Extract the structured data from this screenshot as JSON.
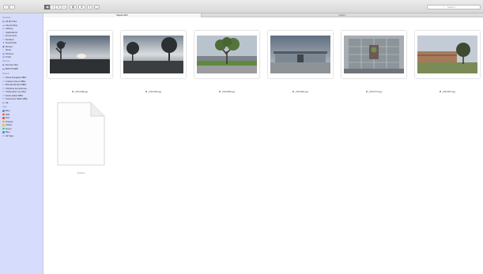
{
  "toolbar": {
    "view_modes": [
      "icon",
      "list",
      "column",
      "gallery"
    ],
    "search_placeholder": "Search"
  },
  "tabs": [
    {
      "label": "Nagano Mini",
      "active": true
    },
    {
      "label": "Nagano",
      "active": false
    }
  ],
  "sidebar": {
    "sections": [
      {
        "header": "Favorites",
        "items": [
          {
            "label": "All My Files",
            "icon": "all-files-icon"
          },
          {
            "label": "iCloud Drive",
            "icon": "cloud-icon"
          },
          {
            "label": "AirDrop",
            "icon": "airdrop-icon"
          },
          {
            "label": "Applications",
            "icon": "applications-icon"
          },
          {
            "label": "Documents",
            "icon": "documents-icon"
          },
          {
            "label": "Desktop",
            "icon": "desktop-icon"
          },
          {
            "label": "Downloads",
            "icon": "downloads-icon"
          },
          {
            "label": "Movies",
            "icon": "movies-icon"
          },
          {
            "label": "Music",
            "icon": "music-icon"
          },
          {
            "label": "Pictures",
            "icon": "pictures-icon"
          },
          {
            "label": "Trash",
            "icon": "trash-icon"
          }
        ]
      },
      {
        "header": "Devices",
        "items": [
          {
            "label": "Remote Disc",
            "icon": "disc-icon"
          },
          {
            "label": "BOOTCAMP",
            "icon": "drive-icon"
          }
        ]
      },
      {
        "header": "Shared",
        "items": [
          {
            "label": "Olivia Douglass MBA",
            "icon": "computer-icon"
          },
          {
            "label": "Andrew Cicero MBA",
            "icon": "computer-icon"
          },
          {
            "label": "Brenda Richard MBA",
            "icon": "computer-icon"
          },
          {
            "label": "Christina Konschewa...",
            "icon": "computer-icon"
          },
          {
            "label": "Christopher Lee Mac",
            "icon": "computer-icon"
          },
          {
            "label": "Emily-Isabel MBA",
            "icon": "computer-icon"
          },
          {
            "label": "Francesca Salas MBA",
            "icon": "computer-icon"
          },
          {
            "label": "All...",
            "icon": "globe-icon"
          }
        ]
      },
      {
        "header": "Tags",
        "items": [
          {
            "label": "Blue",
            "color": "#4a90d9"
          },
          {
            "label": "WIP",
            "color": "#e74c3c"
          },
          {
            "label": "Red",
            "color": "#e74c3c"
          },
          {
            "label": "Orange",
            "color": "#f39c12"
          },
          {
            "label": "Yellow",
            "color": "#f1c40f"
          },
          {
            "label": "Green",
            "color": "#2ecc71"
          },
          {
            "label": "Blue",
            "color": "#4a90d9"
          },
          {
            "label": "All Tags...",
            "color": "#bbbbbb"
          }
        ]
      }
    ]
  },
  "files": [
    {
      "name": "_DSC0182.jpg"
    },
    {
      "name": "_DSC0162.jpg"
    },
    {
      "name": "_DSC0663.jpg"
    },
    {
      "name": "_DSC0641.jpg"
    },
    {
      "name": "_DSC0774.jpg"
    },
    {
      "name": "_DSC0671.jpg"
    }
  ],
  "doc_file": {
    "name": "All Done"
  }
}
